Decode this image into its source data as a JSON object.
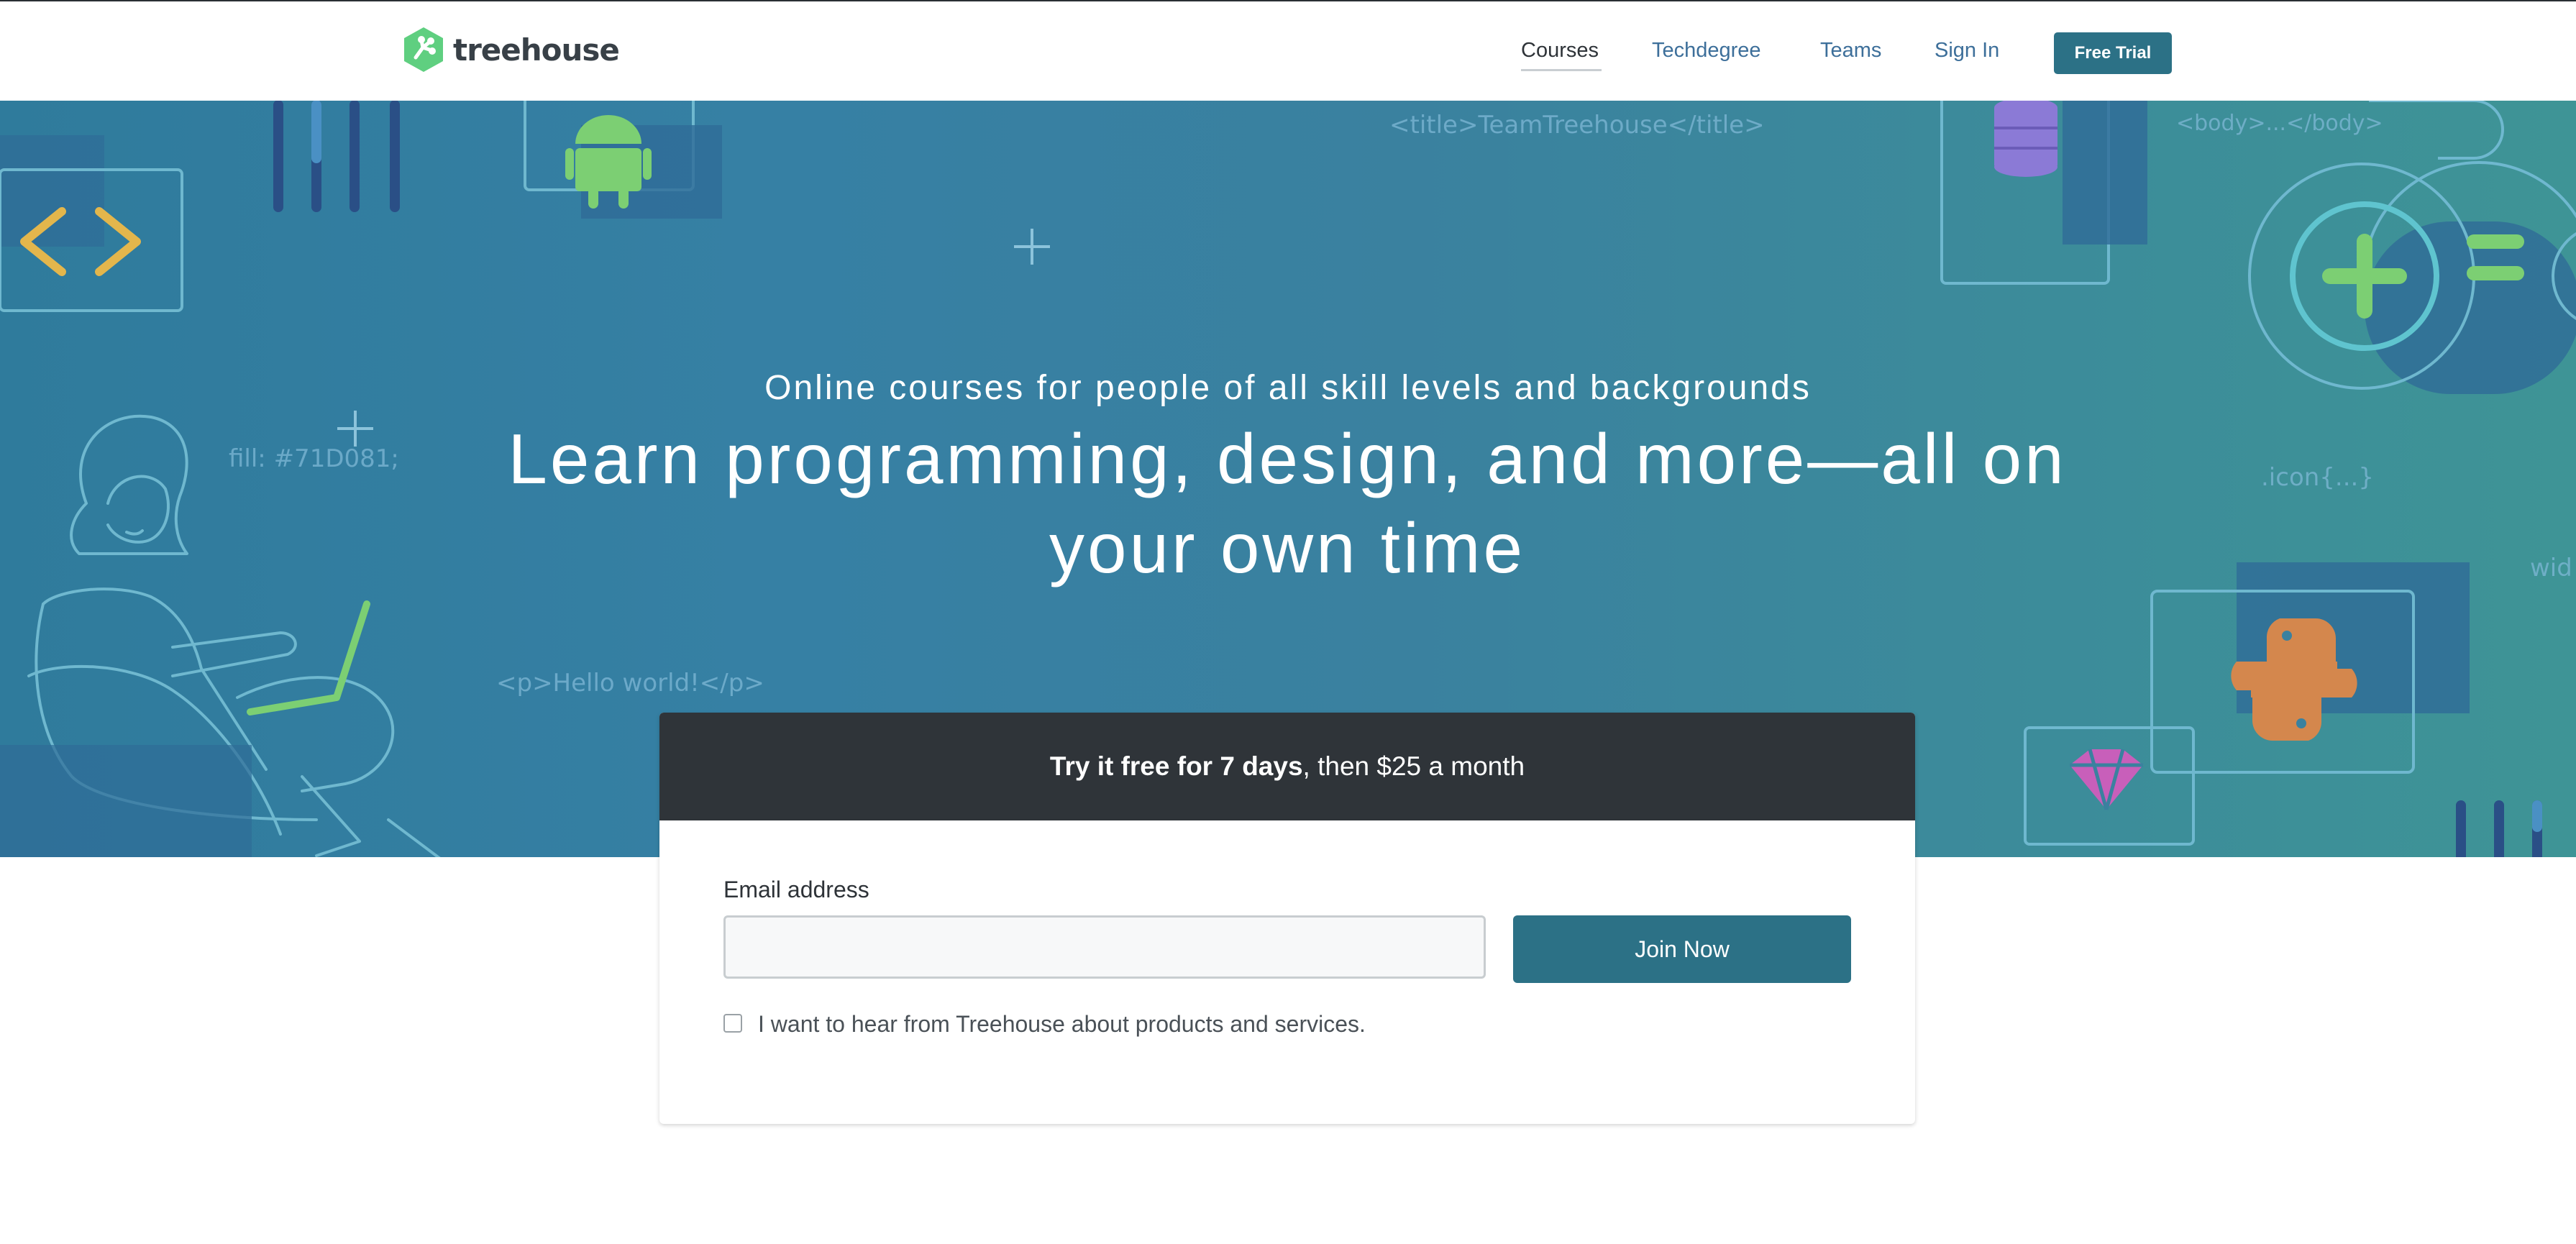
{
  "brand": {
    "name": "treehouse",
    "logo_color": "#5fcf80"
  },
  "nav": {
    "items": [
      {
        "label": "Courses",
        "active": true
      },
      {
        "label": "Techdegree"
      },
      {
        "label": "Teams"
      },
      {
        "label": "Sign In"
      }
    ],
    "cta": "Free Trial"
  },
  "hero": {
    "subtitle": "Online courses for people of all skill levels and backgrounds",
    "title": "Learn programming, design, and more—all on your own time",
    "decor_text": {
      "title_tag": "<title>TeamTreehouse</title>",
      "body_tag": "<body>...</body>",
      "fill": "fill: #71D081;",
      "icon_rule": ".icon{...}",
      "width_rule": "wid",
      "hello": "<p>Hello world!</p>"
    }
  },
  "signup": {
    "headline_bold": "Try it free for 7 days",
    "headline_rest": ", then $25 a month",
    "email_label": "Email address",
    "email_value": "",
    "button": "Join Now",
    "optin_label": "I want to hear from Treehouse about products and services.",
    "optin_checked": false
  },
  "colors": {
    "accent": "#2c7186",
    "nav_link": "#3d6f9a",
    "card_header": "#2f3439",
    "hero_blue": "#3680a4",
    "hero_teal": "#3e9496"
  }
}
